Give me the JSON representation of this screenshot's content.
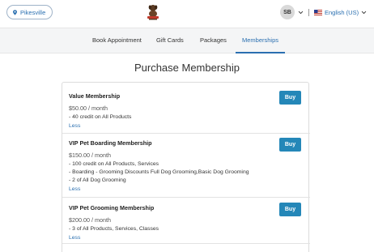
{
  "header": {
    "location": "Pikesville",
    "user_initials": "SB",
    "language": "English (US)"
  },
  "nav": {
    "tabs": [
      "Book Appointment",
      "Gift Cards",
      "Packages",
      "Memberships"
    ],
    "active": "Memberships"
  },
  "page": {
    "title": "Purchase Membership"
  },
  "memberships": [
    {
      "name": "Value Membership",
      "price": "$50.00 / month",
      "benefits": [
        "-  40 credit on All Products"
      ],
      "toggle": "Less",
      "button": "Buy"
    },
    {
      "name": "VIP Pet Boarding Membership",
      "price": "$150.00 / month",
      "benefits": [
        "-  100 credit on All Products, Services",
        "-  Boarding - Grooming Discounts Full Dog Grooming,Basic Dog Grooming",
        "-  2 of All Dog Grooming"
      ],
      "toggle": "Less",
      "button": "Buy"
    },
    {
      "name": "VIP Pet Grooming Membership",
      "price": "$200.00 / month",
      "benefits": [
        "-  3 of All Products, Services, Classes"
      ],
      "toggle": "Less",
      "button": "Buy"
    }
  ],
  "colors": {
    "accent": "#2a6fb0",
    "button": "#2487b8",
    "nav_bg": "#f4f5f6"
  },
  "icons": {
    "location": "map-pin-icon",
    "logo": "dog-logo-icon",
    "flag": "us-flag-icon",
    "dropdown": "chevron-down-icon"
  }
}
